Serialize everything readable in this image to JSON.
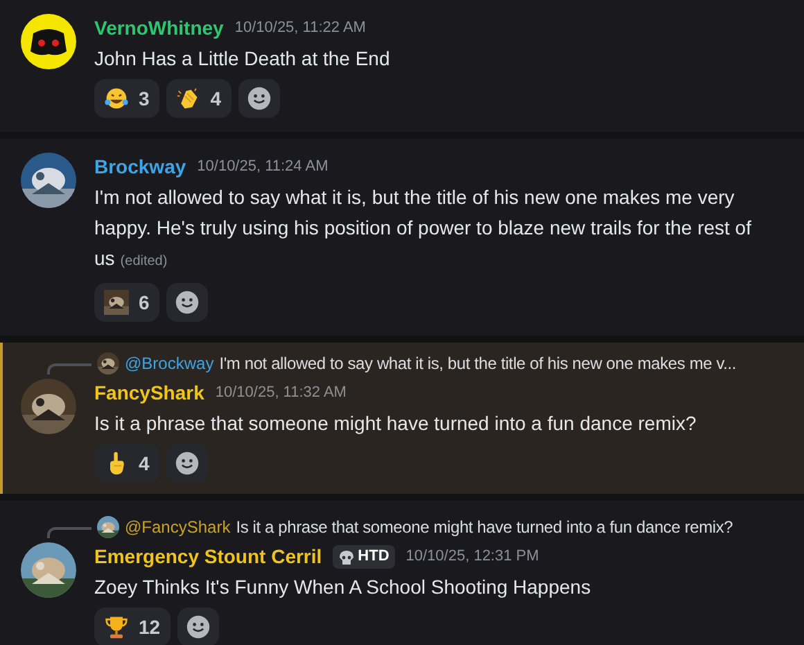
{
  "messages": [
    {
      "avatar": {
        "kind": "bot"
      },
      "author": "VernoWhitney",
      "color": "#2dc770",
      "timestamp": "10/10/25, 11:22 AM",
      "text": "John Has a Little Death at the End",
      "edited": false,
      "highlighted": false,
      "reactions": [
        {
          "kind": "laugh",
          "count": "3"
        },
        {
          "kind": "clap",
          "count": "4"
        }
      ]
    },
    {
      "avatar": {
        "kind": "picture"
      },
      "author": "Brockway",
      "color": "#3ba5e8",
      "timestamp": "10/10/25, 11:24 AM",
      "text": "I'm not allowed to say what it is, but the title of his new one makes me very happy. He's truly using his position of power to blaze new trails for the rest of us",
      "edited_label": "(edited)",
      "edited": true,
      "highlighted": false,
      "reactions": [
        {
          "kind": "picture",
          "count": "6"
        }
      ]
    },
    {
      "avatar": {
        "kind": "picture"
      },
      "author": "FancyShark",
      "color": "#f0c419",
      "timestamp": "10/10/25, 11:32 AM",
      "text": "Is it a phrase that someone might have turned into a fun dance remix?",
      "edited": false,
      "highlighted": true,
      "reply": {
        "author": "@Brockway",
        "color": "#3ba5e8",
        "text": "I'm not allowed to say what it is, but the title of his new one makes me v..."
      },
      "reactions": [
        {
          "kind": "point",
          "count": "4"
        }
      ]
    },
    {
      "avatar": {
        "kind": "picture"
      },
      "author": "Emergency Stount Cerril",
      "color": "#f0c419",
      "tag": "HTD",
      "timestamp": "10/10/25, 12:31 PM",
      "text": "Zoey Thinks It's Funny When A School Shooting Happens",
      "edited": false,
      "highlighted": false,
      "reply": {
        "author": "@FancyShark",
        "color": "#c9a227",
        "text": "Is it a phrase that someone might have turned into a fun dance remix?"
      },
      "reactions": [
        {
          "kind": "trophy",
          "count": "12"
        }
      ]
    }
  ]
}
